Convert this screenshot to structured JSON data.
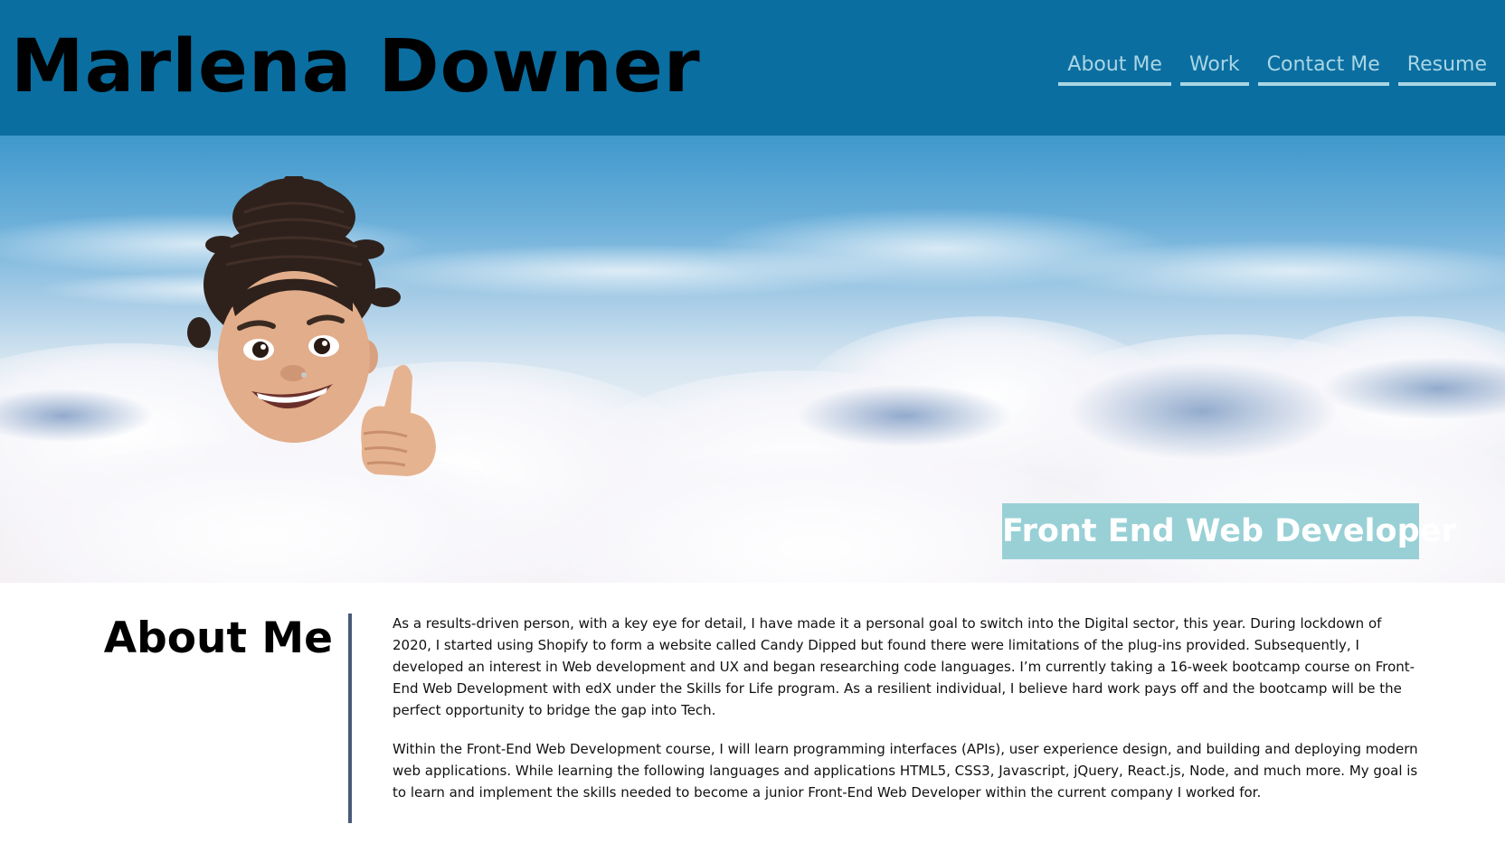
{
  "header": {
    "site_title": "Marlena Downer",
    "background_color": "#0b6ea0",
    "title_color": "#000000",
    "nav_color": "#a9d6e5",
    "nav": [
      {
        "label": "About Me"
      },
      {
        "label": "Work"
      },
      {
        "label": "Contact Me"
      },
      {
        "label": "Resume"
      }
    ]
  },
  "hero": {
    "subtitle": "Front End Web Developer",
    "subtitle_background": "#98d0d6",
    "image_subject": "memoji-thumbs-up",
    "background_subject": "sky-above-clouds"
  },
  "about": {
    "heading": "About Me",
    "divider_color": "#4a5a7a",
    "paragraphs": [
      "As a results-driven person, with a key eye for detail, I have made it a personal goal to switch into the Digital sector, this year. During lockdown of 2020, I started using Shopify to form a website called Candy Dipped but found there were limitations of the plug-ins provided. Subsequently, I developed an interest in Web development and UX and began researching code languages. I’m currently taking a 16-week bootcamp course on Front-End Web Development with edX under the Skills for Life program. As a resilient individual, I believe hard work pays off and the bootcamp will be the perfect opportunity to bridge the gap into Tech.",
      "Within the Front-End Web Development course, I will learn programming interfaces (APIs), user experience design, and building and deploying modern web applications. While learning the following languages and applications HTML5, CSS3, Javascript, jQuery, React.js, Node, and much more. My goal is to learn and implement the skills needed to become a junior Front-End Web Developer within the current company I worked for."
    ]
  }
}
